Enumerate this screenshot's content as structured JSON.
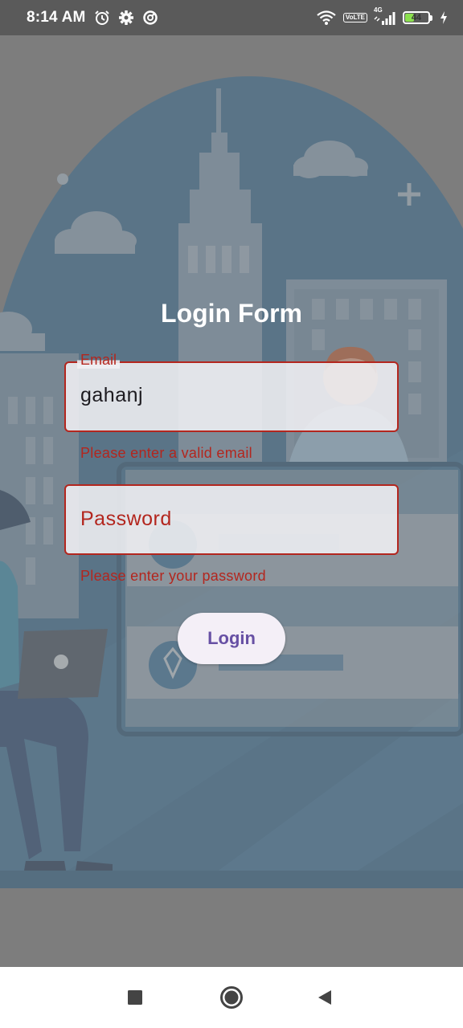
{
  "status_bar": {
    "time": "8:14 AM",
    "left_icons": [
      "alarm-icon",
      "gear-icon",
      "data-saver-icon"
    ],
    "right_icons": [
      "wifi-icon",
      "volte-icon",
      "signal-icon",
      "battery-icon",
      "charging-icon"
    ],
    "volte_label_top": "Vo",
    "volte_label_bottom": "LTE",
    "network_type": "4G",
    "battery_level": "44"
  },
  "form": {
    "title": "Login Form",
    "email": {
      "label": "Email",
      "value": "gahanj",
      "error": "Please enter a valid email"
    },
    "password": {
      "placeholder": "Password",
      "error": "Please enter your password"
    },
    "login_button_label": "Login"
  },
  "colors": {
    "error": "#b3261e",
    "button_text": "#6750a4",
    "button_bg": "#f4eff7",
    "overlay": "#7b7b7b",
    "illustration_blue": "#2f6f9e"
  },
  "nav_bar": {
    "buttons": [
      "recents-icon",
      "home-icon",
      "back-icon"
    ]
  }
}
